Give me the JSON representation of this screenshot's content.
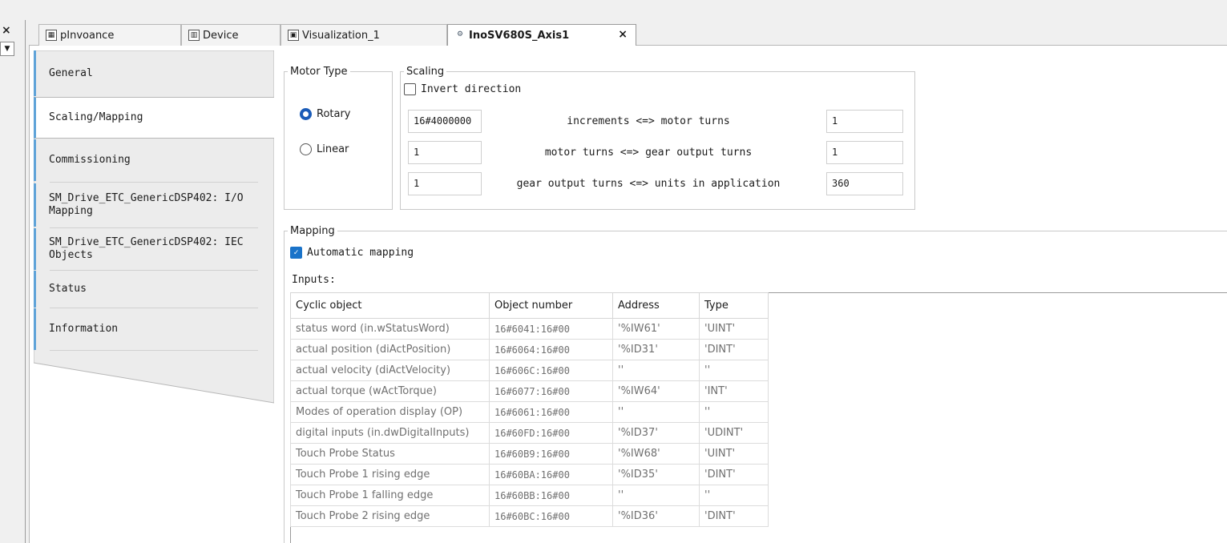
{
  "left_panel": {
    "close_glyph": "×",
    "dropdown_glyph": "▼"
  },
  "tabs": [
    {
      "label": "pInvoance",
      "icon": "document-icon",
      "glyph": "▦"
    },
    {
      "label": "Device",
      "icon": "device-icon",
      "glyph": "▥"
    },
    {
      "label": "Visualization_1",
      "icon": "visualization-icon",
      "glyph": "▣"
    },
    {
      "label": "InoSV680S_Axis1",
      "icon": "axis-icon",
      "glyph": "⚙",
      "active": true,
      "close_glyph": "×"
    }
  ],
  "nav": [
    {
      "label": "General"
    },
    {
      "label": "Scaling/Mapping",
      "active": true
    },
    {
      "label": "Commissioning"
    },
    {
      "label": "SM_Drive_ETC_GenericDSP402: I/O Mapping"
    },
    {
      "label": "SM_Drive_ETC_GenericDSP402: IEC Objects"
    },
    {
      "label": "Status"
    },
    {
      "label": "Information"
    }
  ],
  "motor_type": {
    "title": "Motor Type",
    "rotary": "Rotary",
    "linear": "Linear",
    "selected": "Rotary"
  },
  "scaling": {
    "title": "Scaling",
    "invert_direction": "Invert direction",
    "invert_checked": false,
    "rows": [
      {
        "left": "16#4000000",
        "label": "increments <=> motor turns",
        "right": "1"
      },
      {
        "left": "1",
        "label": "motor turns <=> gear output turns",
        "right": "1"
      },
      {
        "left": "1",
        "label": "gear output turns <=> units in application",
        "right": "360"
      }
    ]
  },
  "mapping": {
    "title": "Mapping",
    "automatic": "Automatic mapping",
    "automatic_checked": true,
    "check_glyph": "✓",
    "inputs_label": "Inputs:",
    "columns": [
      "Cyclic object",
      "Object number",
      "Address",
      "Type"
    ],
    "rows": [
      [
        "status word (in.wStatusWord)",
        "16#6041:16#00",
        "'%IW61'",
        "'UINT'"
      ],
      [
        "actual position (diActPosition)",
        "16#6064:16#00",
        "'%ID31'",
        "'DINT'"
      ],
      [
        "actual velocity (diActVelocity)",
        "16#606C:16#00",
        "''",
        "''"
      ],
      [
        "actual torque (wActTorque)",
        "16#6077:16#00",
        "'%IW64'",
        "'INT'"
      ],
      [
        "Modes of operation display (OP)",
        "16#6061:16#00",
        "''",
        "''"
      ],
      [
        "digital inputs (in.dwDigitalInputs)",
        "16#60FD:16#00",
        "'%ID37'",
        "'UDINT'"
      ],
      [
        "Touch Probe Status",
        "16#60B9:16#00",
        "'%IW68'",
        "'UINT'"
      ],
      [
        "Touch Probe 1 rising edge",
        "16#60BA:16#00",
        "'%ID35'",
        "'DINT'"
      ],
      [
        "Touch Probe 1 falling edge",
        "16#60BB:16#00",
        "''",
        "''"
      ],
      [
        "Touch Probe 2 rising edge",
        "16#60BC:16#00",
        "'%ID36'",
        "'DINT'"
      ]
    ]
  }
}
